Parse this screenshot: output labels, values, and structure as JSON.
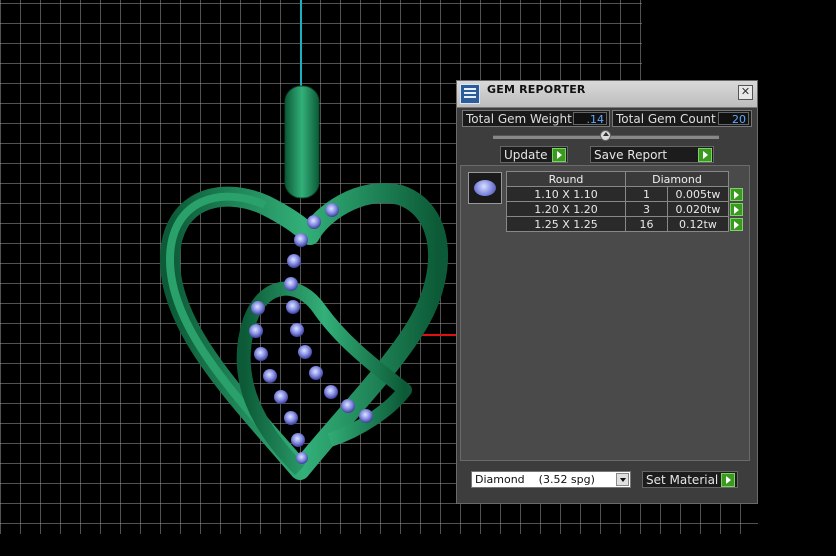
{
  "panel": {
    "title": "GEM REPORTER",
    "close_glyph": "✕",
    "total_weight_label": "Total Gem Weight",
    "total_weight_value": ".14",
    "total_count_label": "Total Gem Count",
    "total_count_value": "20",
    "update_label": "Update",
    "save_report_label": "Save Report",
    "table": {
      "headers": [
        "Round",
        "Diamond"
      ],
      "rows": [
        {
          "size": "1.10 X 1.10",
          "count": "1",
          "weight": "0.005tw"
        },
        {
          "size": "1.20 X 1.20",
          "count": "3",
          "weight": "0.020tw"
        },
        {
          "size": "1.25 X 1.25",
          "count": "16",
          "weight": "0.12tw"
        }
      ]
    },
    "material_select": "Diamond    (3.52 spg)",
    "set_material_label": "Set Material"
  },
  "colors": {
    "model_green": "#1f8a5b",
    "gem_blue": "#8c94e8",
    "axis_cyan": "#1ab0c0",
    "axis_red": "#e01010",
    "panel_bg": "#3d3d3d",
    "accent_green": "#3a9a20"
  },
  "icons": {
    "title": "gem-reporter-icon",
    "close": "close-icon",
    "go": "arrow-right-icon",
    "gem": "round-gem-icon"
  }
}
